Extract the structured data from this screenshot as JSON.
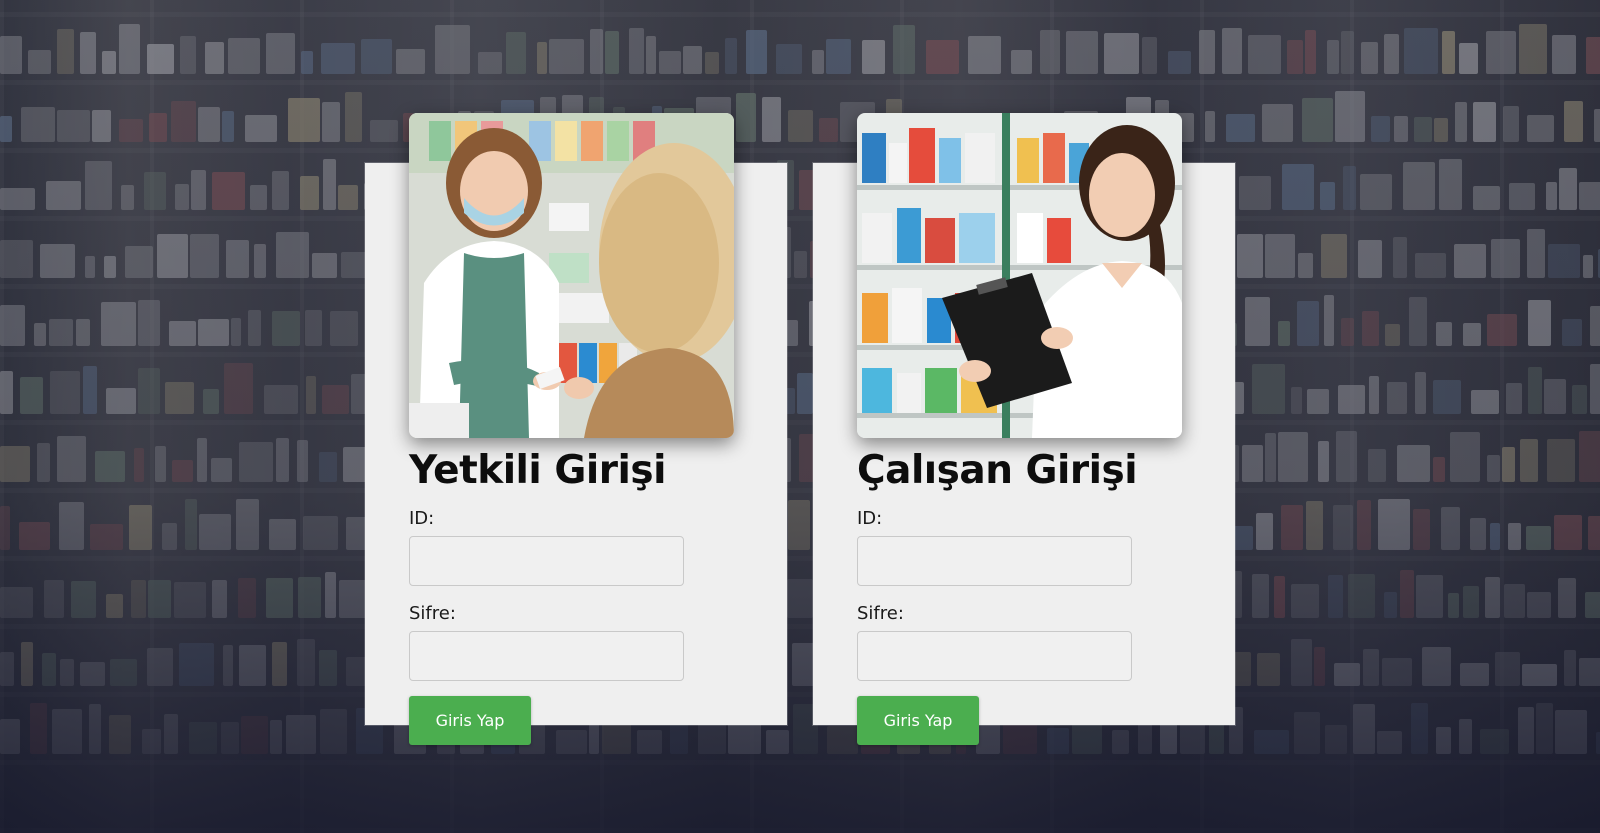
{
  "colors": {
    "card_background": "#efefef",
    "button_green": "#4bae4f",
    "title_text": "#0d0d0d"
  },
  "login_cards": [
    {
      "title": "Yetkili Girişi",
      "photo": "pharmacist-serving-customer-photo",
      "id_label": "ID:",
      "id_value": "",
      "password_label": "Sifre:",
      "password_value": "",
      "button_label": "Giris Yap"
    },
    {
      "title": "Çalışan Girişi",
      "photo": "pharmacist-with-clipboard-photo",
      "id_label": "ID:",
      "id_value": "",
      "password_label": "Sifre:",
      "password_value": "",
      "button_label": "Giris Yap"
    }
  ]
}
